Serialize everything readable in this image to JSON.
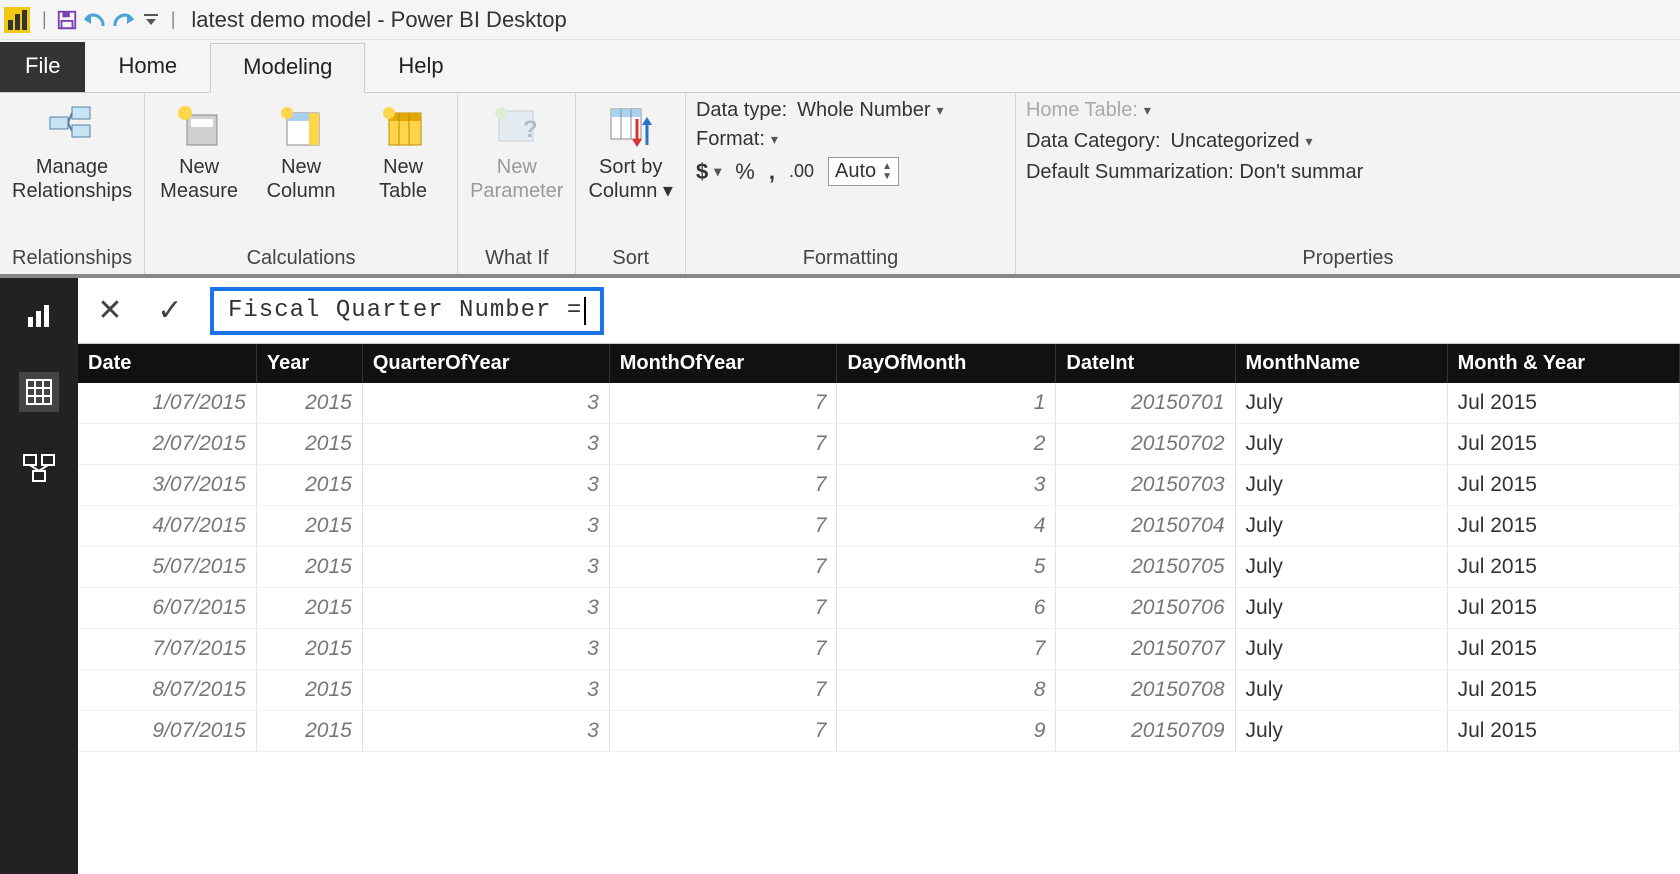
{
  "title": "latest demo model - Power BI Desktop",
  "tabs": {
    "file": "File",
    "home": "Home",
    "modeling": "Modeling",
    "help": "Help"
  },
  "ribbon": {
    "relationships": {
      "manage": "Manage\nRelationships",
      "group": "Relationships"
    },
    "calculations": {
      "measure": "New\nMeasure",
      "column": "New\nColumn",
      "table": "New\nTable",
      "group": "Calculations"
    },
    "whatif": {
      "param": "New\nParameter",
      "group": "What If"
    },
    "sort": {
      "sortby": "Sort by\nColumn",
      "group": "Sort"
    },
    "formatting": {
      "datatype_label": "Data type:",
      "datatype_value": "Whole Number",
      "format_label": "Format:",
      "currency": "$",
      "percent": "%",
      "comma": ",",
      "decimals": ".00",
      "auto": "Auto",
      "group": "Formatting"
    },
    "properties": {
      "home_table": "Home Table:",
      "category_label": "Data Category:",
      "category_value": "Uncategorized",
      "summarization": "Default Summarization: Don't summar",
      "group": "Properties"
    }
  },
  "formula": {
    "text": "Fiscal Quarter Number = "
  },
  "table": {
    "headers": [
      "Date",
      "Year",
      "QuarterOfYear",
      "MonthOfYear",
      "DayOfMonth",
      "DateInt",
      "MonthName",
      "Month & Year"
    ],
    "rows": [
      [
        "1/07/2015",
        "2015",
        "3",
        "7",
        "1",
        "20150701",
        "July",
        "Jul 2015"
      ],
      [
        "2/07/2015",
        "2015",
        "3",
        "7",
        "2",
        "20150702",
        "July",
        "Jul 2015"
      ],
      [
        "3/07/2015",
        "2015",
        "3",
        "7",
        "3",
        "20150703",
        "July",
        "Jul 2015"
      ],
      [
        "4/07/2015",
        "2015",
        "3",
        "7",
        "4",
        "20150704",
        "July",
        "Jul 2015"
      ],
      [
        "5/07/2015",
        "2015",
        "3",
        "7",
        "5",
        "20150705",
        "July",
        "Jul 2015"
      ],
      [
        "6/07/2015",
        "2015",
        "3",
        "7",
        "6",
        "20150706",
        "July",
        "Jul 2015"
      ],
      [
        "7/07/2015",
        "2015",
        "3",
        "7",
        "7",
        "20150707",
        "July",
        "Jul 2015"
      ],
      [
        "8/07/2015",
        "2015",
        "3",
        "7",
        "8",
        "20150708",
        "July",
        "Jul 2015"
      ],
      [
        "9/07/2015",
        "2015",
        "3",
        "7",
        "9",
        "20150709",
        "July",
        "Jul 2015"
      ]
    ]
  }
}
